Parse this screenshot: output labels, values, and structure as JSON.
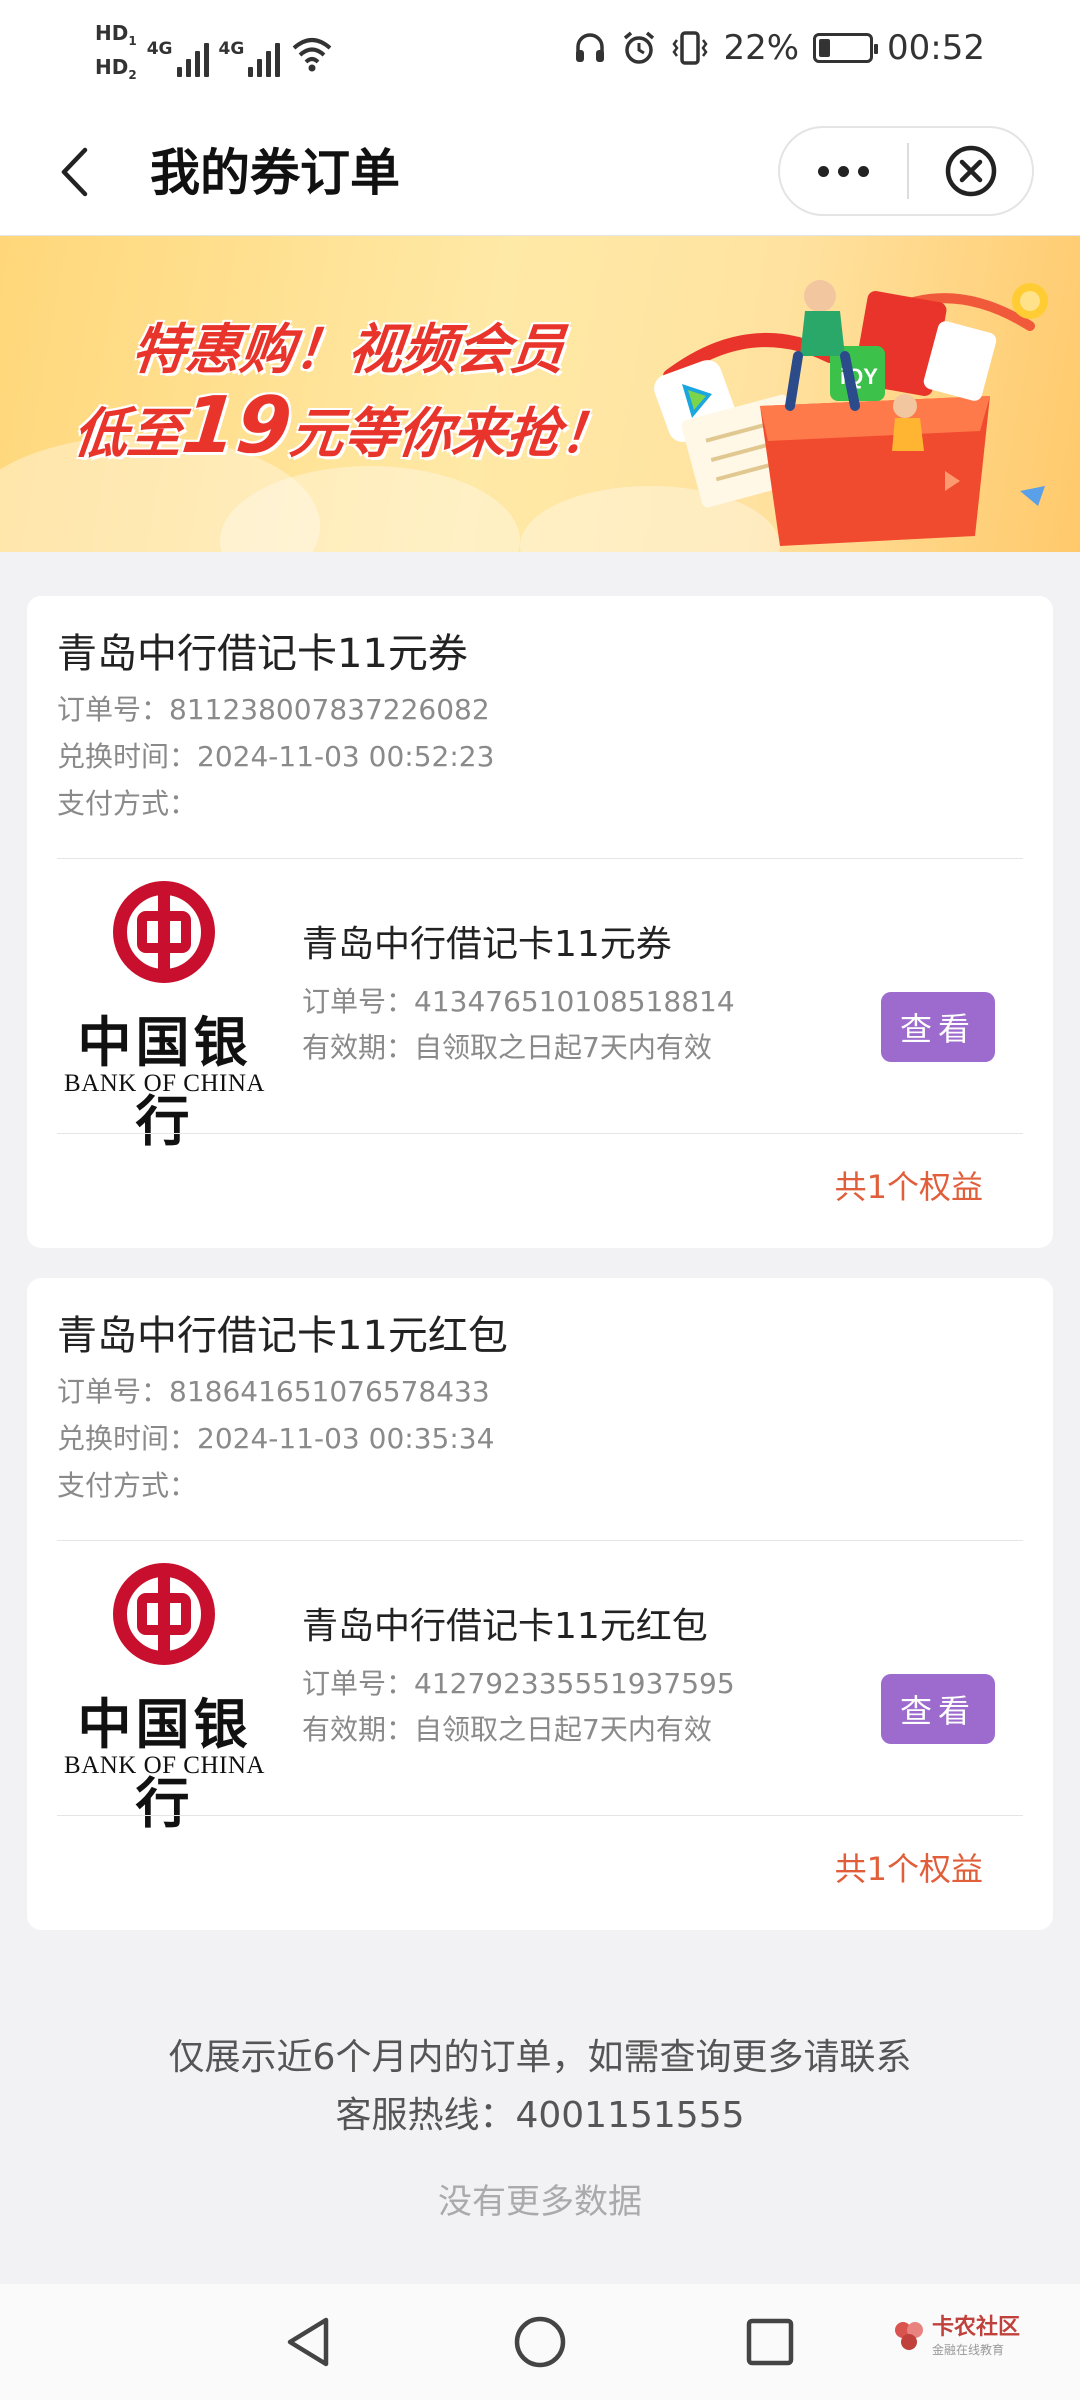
{
  "status_bar": {
    "hd1": "HD",
    "hd1_sub": "1",
    "hd2": "HD",
    "hd2_sub": "2",
    "sig1": "4G",
    "sig2": "4G",
    "battery_pct": "22%",
    "time": "00:52",
    "battery_level": 0.22
  },
  "nav": {
    "title": "我的券订单"
  },
  "banner": {
    "line1": "特惠购！视频会员",
    "line2_a": "低至",
    "line2_num": "19",
    "line2_b": "元等你来抢！"
  },
  "orders": [
    {
      "title": "青岛中行借记卡11元券",
      "order_no_label": "订单号：",
      "order_no": "811238007837226082",
      "time_label": "兑换时间：",
      "time": "2024-11-03 00:52:23",
      "pay_label": "支付方式：",
      "logo_cn": "中国银行",
      "logo_en": "BANK OF CHINA",
      "item_name": "青岛中行借记卡11元券",
      "item_no_label": "订单号：",
      "item_no": "413476510108518814",
      "validity_label": "有效期：",
      "validity": "自领取之日起7天内有效",
      "view_label": "查看",
      "benefit": "共1个权益"
    },
    {
      "title": "青岛中行借记卡11元红包",
      "order_no_label": "订单号：",
      "order_no": "818641651076578433",
      "time_label": "兑换时间：",
      "time": "2024-11-03 00:35:34",
      "pay_label": "支付方式：",
      "logo_cn": "中国银行",
      "logo_en": "BANK OF CHINA",
      "item_name": "青岛中行借记卡11元红包",
      "item_no_label": "订单号：",
      "item_no": "412792335551937595",
      "validity_label": "有效期：",
      "validity": "自领取之日起7天内有效",
      "view_label": "查看",
      "benefit": "共1个权益"
    }
  ],
  "footer": {
    "note_line1": "仅展示近6个月内的订单，如需查询更多请联系",
    "note_line2": "客服热线：4001151555",
    "no_more": "没有更多数据"
  },
  "watermark": {
    "name": "卡农社区",
    "sub": "金融在线教育"
  },
  "colors": {
    "accent_button": "#9d6bce",
    "benefit_text": "#e15e3a",
    "boc_red": "#c8102e"
  }
}
